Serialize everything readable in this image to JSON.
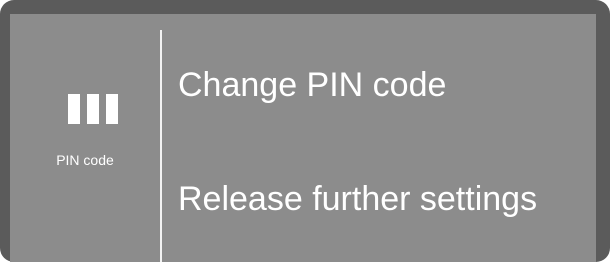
{
  "side_panel": {
    "icon": "pin-dots-icon",
    "label": "PIN code"
  },
  "menu": {
    "items": [
      {
        "label": "Change PIN code"
      },
      {
        "label": "Release further settings"
      }
    ]
  },
  "colors": {
    "bezel": "#5b5b5b",
    "screen": "#8c8c8c",
    "text": "#ffffff"
  }
}
